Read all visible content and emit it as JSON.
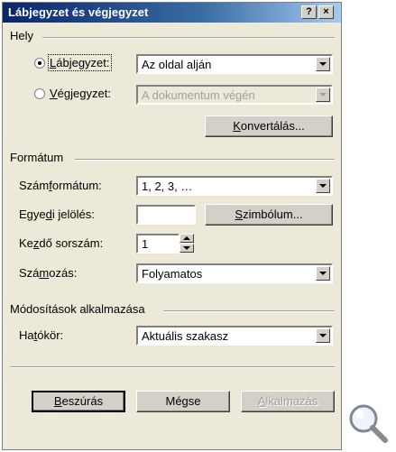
{
  "window": {
    "title": "Lábjegyzet és végjegyzet",
    "help_glyph": "?",
    "close_glyph": "×"
  },
  "hely": {
    "heading": "Hely",
    "footnote": {
      "label_u": "L",
      "label_rest": "ábjegyzet:",
      "value": "Az oldal alján",
      "checked": true
    },
    "endnote": {
      "label_u": "V",
      "label_rest": "égjegyzet:",
      "value": "A dokumentum végén",
      "checked": false
    },
    "convert_button": {
      "u": "K",
      "rest": "onvertálás..."
    }
  },
  "formatum": {
    "heading": "Formátum",
    "number_format": {
      "label_pre": "Szám",
      "label_u": "f",
      "label_post": "ormátum:",
      "value": "1, 2, 3, …"
    },
    "custom_mark": {
      "label_pre": "Egye",
      "label_u": "d",
      "label_post": "i jelölés:",
      "value": ""
    },
    "symbol_button": {
      "u": "S",
      "rest": "zimbólum..."
    },
    "start_at": {
      "label_pre": "Ke",
      "label_u": "z",
      "label_post": "dő sorszám:",
      "value": "1"
    },
    "numbering": {
      "label_pre": "Szá",
      "label_u": "m",
      "label_post": "ozás:",
      "value": "Folyamatos"
    }
  },
  "apply": {
    "heading": "Módosítások alkalmazása",
    "scope": {
      "label_pre": "Ha",
      "label_u": "t",
      "label_post": "ókör:",
      "value": "Aktuális szakasz"
    }
  },
  "buttons": {
    "insert": {
      "u": "B",
      "rest": "eszúrás"
    },
    "cancel": "Mégse",
    "apply": {
      "u": "A",
      "rest": "lkalmazás"
    }
  },
  "colors": {
    "dialog_bg": "#ece9d8",
    "title_start": "#0a246a",
    "title_end": "#a6caf0"
  },
  "icons": {
    "magnifier": "magnifier-icon"
  }
}
